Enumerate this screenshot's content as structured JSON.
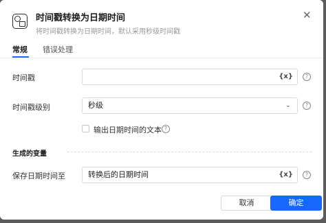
{
  "dialog": {
    "title": "时间戳转换为日期时间",
    "subtitle": "将时间戳转换为日期时间，默认采用秒级时间戳",
    "close_glyph": "✕"
  },
  "tabs": [
    {
      "label": "常规",
      "active": true
    },
    {
      "label": "错误处理",
      "active": false
    }
  ],
  "form": {
    "timestamp": {
      "label": "时间戳",
      "value": "",
      "var_glyph": "{x}"
    },
    "level": {
      "label": "时间戳级别",
      "value": "秒级",
      "chevron": "⌄"
    },
    "output_text": {
      "label": "输出日期时间的文本",
      "checked": false
    },
    "help_glyph": "?"
  },
  "generated_vars": {
    "section_title": "生成的变量",
    "save_to": {
      "label": "保存日期时间至",
      "value": "转换后的日期时间",
      "var_glyph": "{x}"
    }
  },
  "buttons": {
    "cancel": "取消",
    "ok": "确定"
  },
  "colors": {
    "accent": "#1668ff",
    "backdrop": "#5c5c5c"
  }
}
